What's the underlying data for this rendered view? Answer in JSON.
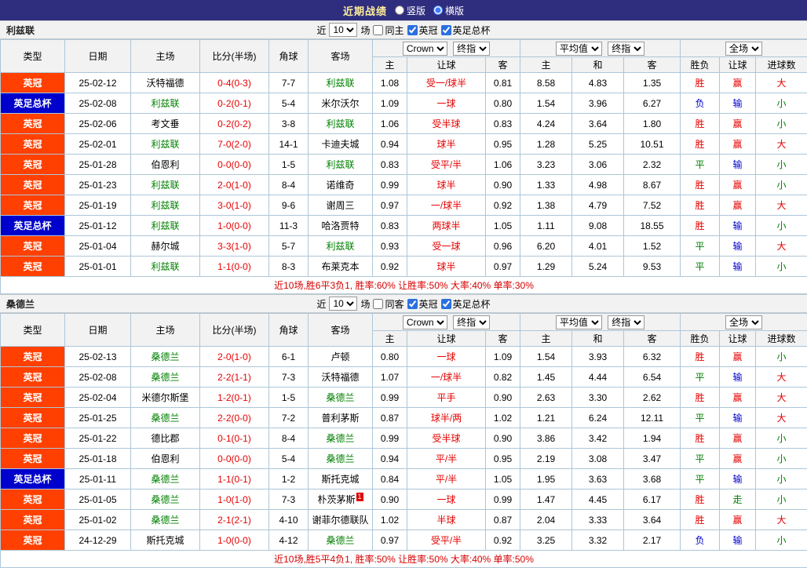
{
  "top_bar": {
    "title": "近期战绩",
    "radios": [
      {
        "label": "竖版",
        "selected": false
      },
      {
        "label": "横版",
        "selected": true
      }
    ]
  },
  "colors": {
    "league": {
      "英冠": "#ff4000",
      "英足总杯": "#0000cc"
    },
    "focal_team": "#008000",
    "opponent_team": "#000000",
    "score": "#e60000",
    "handicap_line": "#e60000",
    "outcome": {
      "胜": "#e60000",
      "平": "#008000",
      "负": "#0000cc",
      "赢": "#e60000",
      "走": "#008000",
      "输": "#0000cc",
      "大": "#e60000",
      "小": "#008000"
    }
  },
  "sections": [
    {
      "team": "利兹联",
      "controls": {
        "near": "近",
        "count": "10",
        "unit": "场",
        "checkboxes": [
          {
            "label": "同主",
            "checked": false
          },
          {
            "label": "英冠",
            "checked": true
          },
          {
            "label": "英足总杯",
            "checked": true
          }
        ]
      },
      "selects": {
        "company": "Crown",
        "company_mode": "终指",
        "average": "平均值",
        "average_mode": "终指",
        "scope": "全场"
      },
      "headers": {
        "main": [
          "类型",
          "日期",
          "主场",
          "比分(半场)",
          "角球",
          "客场"
        ],
        "sub": [
          "主",
          "让球",
          "客",
          "主",
          "和",
          "客",
          "胜负",
          "让球",
          "进球数"
        ]
      },
      "rows": [
        {
          "league": "英冠",
          "date": "25-02-12",
          "home": "沃特福德",
          "score": "0-4(0-3)",
          "corner": "7-7",
          "away": "利兹联",
          "o_home": "1.08",
          "line": "受一/球半",
          "o_away": "0.81",
          "avg_home": "8.58",
          "avg_draw": "4.83",
          "avg_away": "1.35",
          "result": "胜",
          "handicap_res": "赢",
          "goals": "大"
        },
        {
          "league": "英足总杯",
          "date": "25-02-08",
          "home": "利兹联",
          "score": "0-2(0-1)",
          "corner": "5-4",
          "away": "米尔沃尔",
          "o_home": "1.09",
          "line": "一球",
          "o_away": "0.80",
          "avg_home": "1.54",
          "avg_draw": "3.96",
          "avg_away": "6.27",
          "result": "负",
          "handicap_res": "输",
          "goals": "小"
        },
        {
          "league": "英冠",
          "date": "25-02-06",
          "home": "考文垂",
          "score": "0-2(0-2)",
          "corner": "3-8",
          "away": "利兹联",
          "o_home": "1.06",
          "line": "受半球",
          "o_away": "0.83",
          "avg_home": "4.24",
          "avg_draw": "3.64",
          "avg_away": "1.80",
          "result": "胜",
          "handicap_res": "赢",
          "goals": "小"
        },
        {
          "league": "英冠",
          "date": "25-02-01",
          "home": "利兹联",
          "score": "7-0(2-0)",
          "corner": "14-1",
          "away": "卡迪夫城",
          "o_home": "0.94",
          "line": "球半",
          "o_away": "0.95",
          "avg_home": "1.28",
          "avg_draw": "5.25",
          "avg_away": "10.51",
          "result": "胜",
          "handicap_res": "赢",
          "goals": "大"
        },
        {
          "league": "英冠",
          "date": "25-01-28",
          "home": "伯恩利",
          "score": "0-0(0-0)",
          "corner": "1-5",
          "away": "利兹联",
          "o_home": "0.83",
          "line": "受平/半",
          "o_away": "1.06",
          "avg_home": "3.23",
          "avg_draw": "3.06",
          "avg_away": "2.32",
          "result": "平",
          "handicap_res": "输",
          "goals": "小"
        },
        {
          "league": "英冠",
          "date": "25-01-23",
          "home": "利兹联",
          "score": "2-0(1-0)",
          "corner": "8-4",
          "away": "诺维奇",
          "o_home": "0.99",
          "line": "球半",
          "o_away": "0.90",
          "avg_home": "1.33",
          "avg_draw": "4.98",
          "avg_away": "8.67",
          "result": "胜",
          "handicap_res": "赢",
          "goals": "小"
        },
        {
          "league": "英冠",
          "date": "25-01-19",
          "home": "利兹联",
          "score": "3-0(1-0)",
          "corner": "9-6",
          "away": "谢周三",
          "o_home": "0.97",
          "line": "一/球半",
          "o_away": "0.92",
          "avg_home": "1.38",
          "avg_draw": "4.79",
          "avg_away": "7.52",
          "result": "胜",
          "handicap_res": "赢",
          "goals": "大"
        },
        {
          "league": "英足总杯",
          "date": "25-01-12",
          "home": "利兹联",
          "score": "1-0(0-0)",
          "corner": "11-3",
          "away": "哈洛贾特",
          "o_home": "0.83",
          "line": "两球半",
          "o_away": "1.05",
          "avg_home": "1.11",
          "avg_draw": "9.08",
          "avg_away": "18.55",
          "result": "胜",
          "handicap_res": "输",
          "goals": "小"
        },
        {
          "league": "英冠",
          "date": "25-01-04",
          "home": "赫尔城",
          "score": "3-3(1-0)",
          "corner": "5-7",
          "away": "利兹联",
          "o_home": "0.93",
          "line": "受一球",
          "o_away": "0.96",
          "avg_home": "6.20",
          "avg_draw": "4.01",
          "avg_away": "1.52",
          "result": "平",
          "handicap_res": "输",
          "goals": "大"
        },
        {
          "league": "英冠",
          "date": "25-01-01",
          "home": "利兹联",
          "score": "1-1(0-0)",
          "corner": "8-3",
          "away": "布莱克本",
          "o_home": "0.92",
          "line": "球半",
          "o_away": "0.97",
          "avg_home": "1.29",
          "avg_draw": "5.24",
          "avg_away": "9.53",
          "result": "平",
          "handicap_res": "输",
          "goals": "小"
        }
      ],
      "summary": "近10场,胜6平3负1, 胜率:60% 让胜率:50% 大率:40% 单率:30%"
    },
    {
      "team": "桑德兰",
      "controls": {
        "near": "近",
        "count": "10",
        "unit": "场",
        "checkboxes": [
          {
            "label": "同客",
            "checked": false
          },
          {
            "label": "英冠",
            "checked": true
          },
          {
            "label": "英足总杯",
            "checked": true
          }
        ]
      },
      "selects": {
        "company": "Crown",
        "company_mode": "终指",
        "average": "平均值",
        "average_mode": "终指",
        "scope": "全场"
      },
      "headers": {
        "main": [
          "类型",
          "日期",
          "主场",
          "比分(半场)",
          "角球",
          "客场"
        ],
        "sub": [
          "主",
          "让球",
          "客",
          "主",
          "和",
          "客",
          "胜负",
          "让球",
          "进球数"
        ]
      },
      "rows": [
        {
          "league": "英冠",
          "date": "25-02-13",
          "home": "桑德兰",
          "score": "2-0(1-0)",
          "corner": "6-1",
          "away": "卢顿",
          "o_home": "0.80",
          "line": "一球",
          "o_away": "1.09",
          "avg_home": "1.54",
          "avg_draw": "3.93",
          "avg_away": "6.32",
          "result": "胜",
          "handicap_res": "赢",
          "goals": "小"
        },
        {
          "league": "英冠",
          "date": "25-02-08",
          "home": "桑德兰",
          "score": "2-2(1-1)",
          "corner": "7-3",
          "away": "沃特福德",
          "o_home": "1.07",
          "line": "一/球半",
          "o_away": "0.82",
          "avg_home": "1.45",
          "avg_draw": "4.44",
          "avg_away": "6.54",
          "result": "平",
          "handicap_res": "输",
          "goals": "大"
        },
        {
          "league": "英冠",
          "date": "25-02-04",
          "home": "米德尔斯堡",
          "score": "1-2(0-1)",
          "corner": "1-5",
          "away": "桑德兰",
          "o_home": "0.99",
          "line": "平手",
          "o_away": "0.90",
          "avg_home": "2.63",
          "avg_draw": "3.30",
          "avg_away": "2.62",
          "result": "胜",
          "handicap_res": "赢",
          "goals": "大"
        },
        {
          "league": "英冠",
          "date": "25-01-25",
          "home": "桑德兰",
          "score": "2-2(0-0)",
          "corner": "7-2",
          "away": "普利茅斯",
          "o_home": "0.87",
          "line": "球半/两",
          "o_away": "1.02",
          "avg_home": "1.21",
          "avg_draw": "6.24",
          "avg_away": "12.11",
          "result": "平",
          "handicap_res": "输",
          "goals": "大"
        },
        {
          "league": "英冠",
          "date": "25-01-22",
          "home": "德比郡",
          "score": "0-1(0-1)",
          "corner": "8-4",
          "away": "桑德兰",
          "o_home": "0.99",
          "line": "受半球",
          "o_away": "0.90",
          "avg_home": "3.86",
          "avg_draw": "3.42",
          "avg_away": "1.94",
          "result": "胜",
          "handicap_res": "赢",
          "goals": "小"
        },
        {
          "league": "英冠",
          "date": "25-01-18",
          "home": "伯恩利",
          "score": "0-0(0-0)",
          "corner": "5-4",
          "away": "桑德兰",
          "o_home": "0.94",
          "line": "平/半",
          "o_away": "0.95",
          "avg_home": "2.19",
          "avg_draw": "3.08",
          "avg_away": "3.47",
          "result": "平",
          "handicap_res": "赢",
          "goals": "小"
        },
        {
          "league": "英足总杯",
          "date": "25-01-11",
          "home": "桑德兰",
          "score": "1-1(0-1)",
          "corner": "1-2",
          "away": "斯托克城",
          "o_home": "0.84",
          "line": "平/半",
          "o_away": "1.05",
          "avg_home": "1.95",
          "avg_draw": "3.63",
          "avg_away": "3.68",
          "result": "平",
          "handicap_res": "输",
          "goals": "小"
        },
        {
          "league": "英冠",
          "date": "25-01-05",
          "home": "桑德兰",
          "score": "1-0(1-0)",
          "corner": "7-3",
          "away": "朴茨茅斯",
          "away_badge": "1",
          "o_home": "0.90",
          "line": "一球",
          "o_away": "0.99",
          "avg_home": "1.47",
          "avg_draw": "4.45",
          "avg_away": "6.17",
          "result": "胜",
          "handicap_res": "走",
          "goals": "小"
        },
        {
          "league": "英冠",
          "date": "25-01-02",
          "home": "桑德兰",
          "score": "2-1(2-1)",
          "corner": "4-10",
          "away": "谢菲尔德联队",
          "o_home": "1.02",
          "line": "半球",
          "o_away": "0.87",
          "avg_home": "2.04",
          "avg_draw": "3.33",
          "avg_away": "3.64",
          "result": "胜",
          "handicap_res": "赢",
          "goals": "大"
        },
        {
          "league": "英冠",
          "date": "24-12-29",
          "home": "斯托克城",
          "score": "1-0(0-0)",
          "corner": "4-12",
          "away": "桑德兰",
          "o_home": "0.97",
          "line": "受平/半",
          "o_away": "0.92",
          "avg_home": "3.25",
          "avg_draw": "3.32",
          "avg_away": "2.17",
          "result": "负",
          "handicap_res": "输",
          "goals": "小"
        }
      ],
      "summary": "近10场,胜5平4负1, 胜率:50% 让胜率:50% 大率:40% 单率:50%"
    }
  ]
}
